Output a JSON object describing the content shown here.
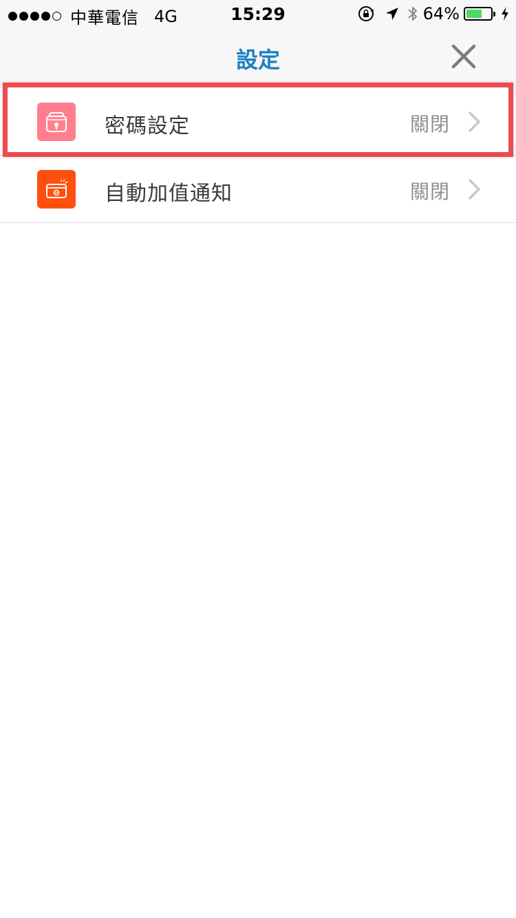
{
  "status_bar": {
    "carrier": "中華電信",
    "network": "4G",
    "time": "15:29",
    "battery_percent_label": "64%",
    "battery_level": 0.64,
    "signal_dots": [
      "filled",
      "filled",
      "filled",
      "filled",
      "empty"
    ]
  },
  "nav": {
    "title": "設定"
  },
  "settings": {
    "items": [
      {
        "label": "密碼設定",
        "value": "關閉",
        "icon": "lock-icon",
        "icon_color": "#ff7f8e"
      },
      {
        "label": "自動加值通知",
        "value": "關閉",
        "icon": "card-icon",
        "icon_color": "#ff4f0f"
      }
    ]
  },
  "colors": {
    "accent": "#1a7fc4",
    "highlight": "#ef4a4d",
    "battery_fill": "#4cd964"
  }
}
